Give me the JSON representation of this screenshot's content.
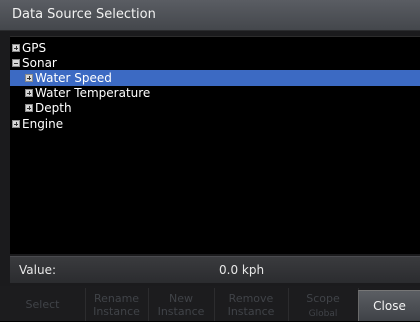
{
  "dialog": {
    "title": "Data Source Selection"
  },
  "tree": {
    "gps": "GPS",
    "sonar": "Sonar",
    "water_speed": "Water Speed",
    "water_temperature": "Water Temperature",
    "depth": "Depth",
    "engine": "Engine"
  },
  "value": {
    "label": "Value:",
    "text": "0.0 kph"
  },
  "softkeys": {
    "select": "Select",
    "rename_1": "Rename",
    "rename_2": "Instance",
    "new_1": "New",
    "new_2": "Instance",
    "remove_1": "Remove",
    "remove_2": "Instance",
    "scope_1": "Scope",
    "scope_2": "Global",
    "close": "Close"
  },
  "colors": {
    "selection": "#3c6ac3",
    "titlebar": "#50535a",
    "disabled_text": "#404348"
  }
}
